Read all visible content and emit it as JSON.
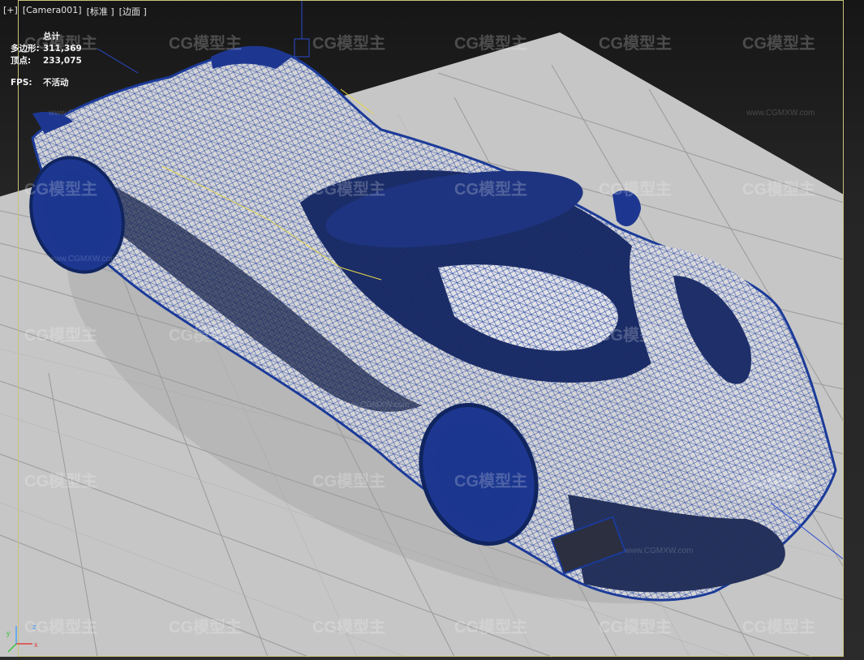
{
  "viewport_menu": {
    "plus": "[+]",
    "camera": "[Camera001]",
    "shading": "[标准 ]",
    "display_mode": "[边面 ]"
  },
  "stats": {
    "header": "总计",
    "polys_label": "多边形:",
    "polys_value": "311,369",
    "verts_label": "顶点:",
    "verts_value": "233,075",
    "fps_label": "FPS:",
    "fps_value": "不活动"
  },
  "watermark": {
    "logo": "CG模型主",
    "url": "www.CGMXW.com"
  },
  "axis": {
    "x": "x",
    "y": "y",
    "z": "z"
  },
  "colors": {
    "wire": "#1d3fa0",
    "body": "#d7d7d7",
    "ground": "#c6c6c6",
    "border": "#c9c27a"
  }
}
